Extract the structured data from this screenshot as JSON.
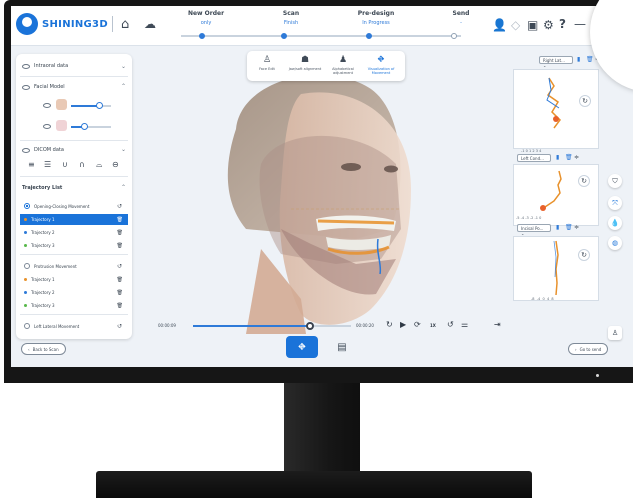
{
  "app": {
    "brand": "SHINING3D"
  },
  "workflow": {
    "steps": [
      {
        "title": "New Order",
        "status": "only"
      },
      {
        "title": "Scan",
        "status": "Finish"
      },
      {
        "title": "Pre-design",
        "status": "In Progress"
      },
      {
        "title": "Send",
        "status": "-"
      }
    ],
    "progress_completed_steps": 2
  },
  "top_icons": [
    "home-icon",
    "cloud-icon",
    "user-icon",
    "diamond-icon",
    "window-icon",
    "gear-icon",
    "help-icon",
    "minimize-icon"
  ],
  "left_panel": {
    "intraoral_label": "Intraoral data",
    "facial_label": "Facial Model",
    "facial_opacity_1": 0.72,
    "facial_opacity_2": 0.35,
    "dicom_label": "DICOM data",
    "trajectory_list_label": "Trajectory List",
    "groups": [
      {
        "name": "Opening-Closing Movement",
        "items": [
          {
            "name": "Trajectory 1",
            "color": "#e8912b",
            "selected": true
          },
          {
            "name": "Trajectory 2",
            "color": "#2e7ad8",
            "selected": false
          },
          {
            "name": "Trajectory 3",
            "color": "#58b84a",
            "selected": false
          }
        ]
      },
      {
        "name": "Protrusion Movement",
        "items": [
          {
            "name": "Trajectory 1",
            "color": "#e8912b",
            "selected": false
          },
          {
            "name": "Trajectory 2",
            "color": "#2e7ad8",
            "selected": false
          },
          {
            "name": "Trajectory 3",
            "color": "#58b84a",
            "selected": false
          }
        ]
      },
      {
        "name": "Left Lateral Movement",
        "items": []
      }
    ]
  },
  "modes": [
    {
      "label": "Face Edit",
      "icon": "person-icon",
      "active": false
    },
    {
      "label": "Jaw/soft alignment",
      "icon": "jaw-icon",
      "active": false
    },
    {
      "label": "Alphabetical adjustment",
      "icon": "bust-icon",
      "active": false
    },
    {
      "label": "Visualization of Movement",
      "icon": "teeth-motion-icon",
      "active": true
    }
  ],
  "playback": {
    "current": "00:00:09",
    "total": "00:00:20",
    "progress": 0.74,
    "speed": "1X"
  },
  "nav": {
    "back": "Back to Scan",
    "next": "Go to send"
  },
  "right_panel": {
    "view_select_1": "Right Lat...",
    "view_select_2": "Left Cond...",
    "view_select_3": "Incisal Po...",
    "ticks_1": [
      "-1",
      "0",
      "1",
      "2",
      "3",
      "4"
    ],
    "ticks_2": [
      "-5",
      "-4",
      "-3",
      "-2",
      "-1",
      "0"
    ],
    "ticks_3": [
      "-8",
      "-4",
      "0",
      "4",
      "8"
    ]
  },
  "colors": {
    "accent": "#1a73d9",
    "orange": "#e8912b"
  }
}
